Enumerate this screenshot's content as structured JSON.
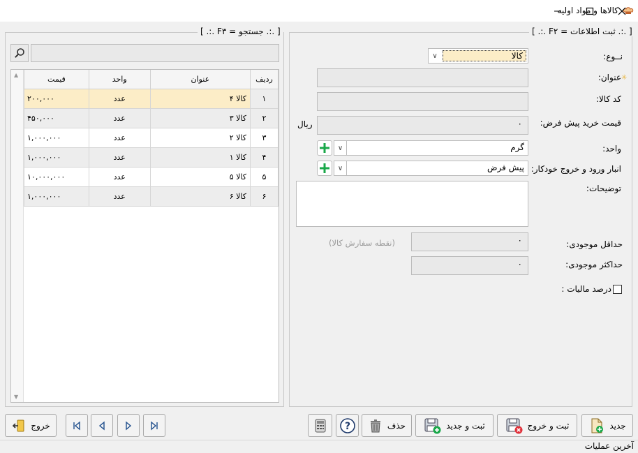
{
  "window": {
    "title": "کالاها و مواد اولیه",
    "icon": "chef-hat-icon",
    "controls": [
      "minimize-icon",
      "maximize-icon",
      "close-icon"
    ]
  },
  "search_panel": {
    "legend": "[ .:. F۳ = جستجو .:. ]",
    "search_value": "",
    "search_icon": "magnifier-icon",
    "columns": {
      "rowno": "ردیف",
      "title": "عنوان",
      "unit": "واحد",
      "price": "قیمت"
    },
    "rows": [
      {
        "rowno": "۱",
        "title": "کالا ۴",
        "unit": "عدد",
        "price": "۲۰۰,۰۰۰"
      },
      {
        "rowno": "۲",
        "title": "کالا ۳",
        "unit": "عدد",
        "price": "۴۵۰,۰۰۰"
      },
      {
        "rowno": "۳",
        "title": "کالا ۲",
        "unit": "عدد",
        "price": "۱,۰۰۰,۰۰۰"
      },
      {
        "rowno": "۴",
        "title": "کالا ۱",
        "unit": "عدد",
        "price": "۱,۰۰۰,۰۰۰"
      },
      {
        "rowno": "۵",
        "title": "کالا ۵",
        "unit": "عدد",
        "price": "۱۰,۰۰۰,۰۰۰"
      },
      {
        "rowno": "۶",
        "title": "کالا ۶",
        "unit": "عدد",
        "price": "۱,۰۰۰,۰۰۰"
      }
    ]
  },
  "form": {
    "legend": "[ .:. F۲ = ثبت اطلاعات .:. ]",
    "type_label": "نــوع:",
    "type_value": "کالا",
    "title_label": "عنوان:",
    "code_label": "کد کالا:",
    "price_label": "قیمت خرید پیش فرض:",
    "price_value": "۰",
    "currency": "ریال",
    "unit_label": "واحد:",
    "unit_value": "گرم",
    "warehouse_label": "انبار ورود و خروج خودکار:",
    "warehouse_value": "پیش فرض",
    "description_label": "توضیحات:",
    "min_stock_label": "حداقل موجودی:",
    "min_stock_value": "۰",
    "reorder_hint": "(نقطه سفارش کالا)",
    "max_stock_label": "حداکثر موجودی:",
    "max_stock_value": "۰",
    "tax_label": "درصد مالیات :",
    "tax_checked": false
  },
  "toolbar": {
    "exit": "خروج",
    "new": "جدید",
    "save_exit": "ثبت و خروج",
    "save_new": "ثبت و جدید",
    "delete": "حذف"
  },
  "status_bar": {
    "text": "آخرین عملیات"
  },
  "colors": {
    "selected_row": "#fcedc7",
    "plus_green": "#1aa84a",
    "accent_orange": "#e07b2a"
  }
}
